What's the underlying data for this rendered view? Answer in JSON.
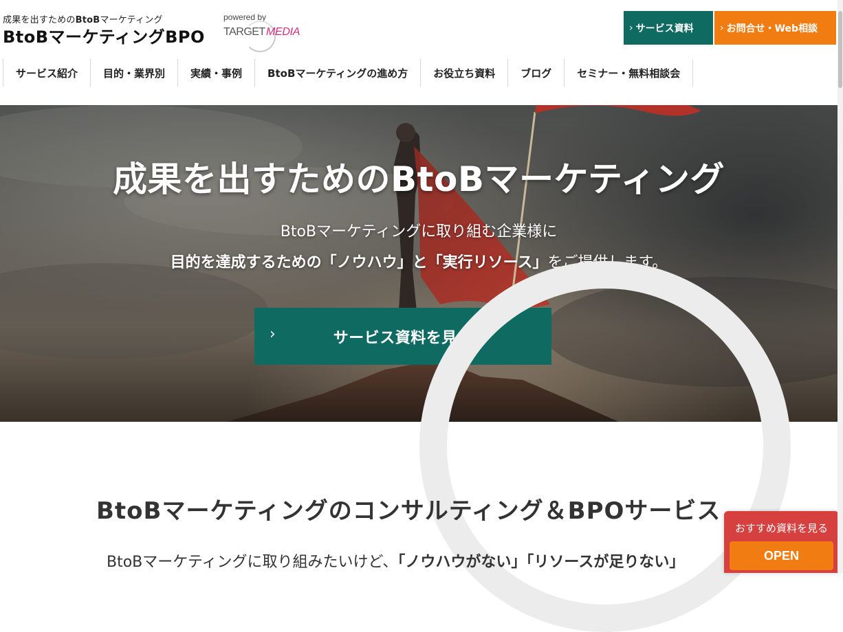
{
  "header": {
    "tagline_pre": "成果を出すための",
    "tagline_bold": "BtoB",
    "tagline_post": "マーケティング",
    "site_title": "BtoBマーケティングBPO",
    "powered_by": "powered by",
    "logo_target": "TARGET",
    "logo_media": "MEDIA",
    "buttons": {
      "service_docs": "サービス資料",
      "contact": "お問合せ・Web相談"
    },
    "icons": {
      "chevron": "chevron-right-icon"
    }
  },
  "nav": {
    "items": [
      "サービス紹介",
      "目的・業界別",
      "実績・事例",
      "BtoBマーケティングの進め方",
      "お役立ち資料",
      "ブログ",
      "セミナー・無料相談会"
    ]
  },
  "hero": {
    "title": "成果を出すためのBtoBマーケティング",
    "line1": "BtoBマーケティングに取り組む企業様に",
    "line2_bold": "目的を達成するための「ノウハウ」と「実行リソース」",
    "line2_post": "をご提供します。",
    "cta": "サービス資料を見る"
  },
  "section": {
    "title": "BtoBマーケティングのコンサルティング＆BPOサービス",
    "text_pre": "BtoBマーケティングに取り組みたいけど、",
    "text_bold": "「ノウハウがない」「リソースが足りない」"
  },
  "float": {
    "label": "おすすめ資料を見る",
    "open": "OPEN"
  },
  "colors": {
    "teal": "#0f6a62",
    "orange": "#f07c12",
    "red": "#d6403e",
    "media_pink": "#d92c7f"
  }
}
